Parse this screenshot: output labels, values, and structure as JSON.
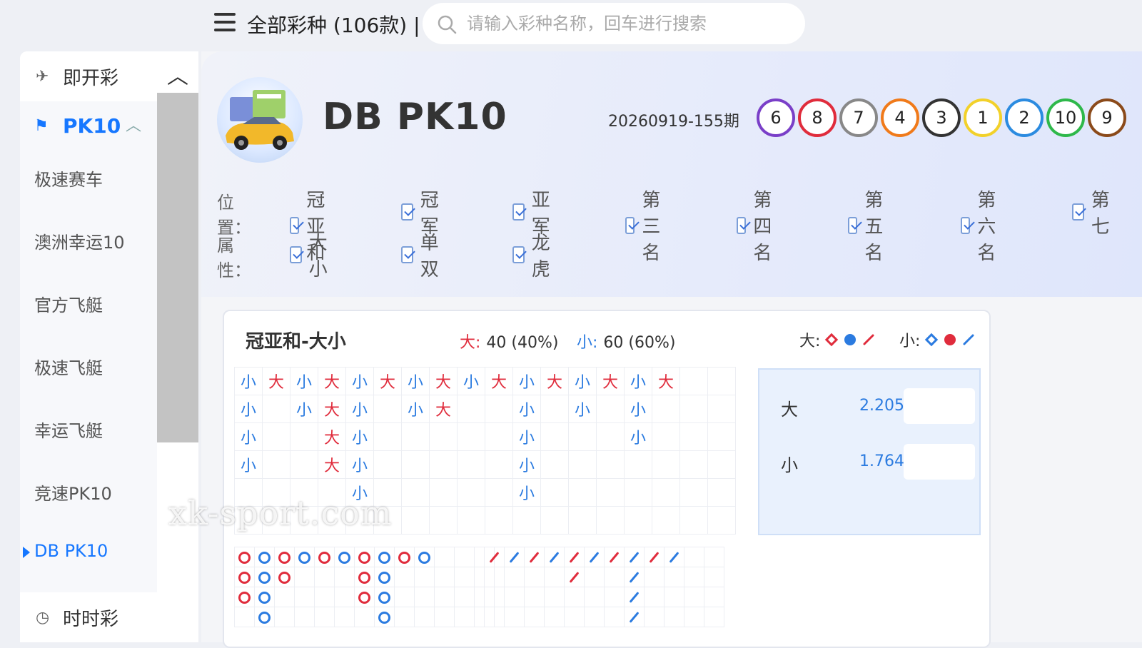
{
  "topbar": {
    "all_games_label": "全部彩种 (106款) |",
    "search_placeholder": "请输入彩种名称，回车进行搜索"
  },
  "sidebar": {
    "group_instant": "即开彩",
    "group_pk10": "PK10",
    "items": [
      "极速赛车",
      "澳洲幸运10",
      "官方飞艇",
      "极速飞艇",
      "幸运飞艇",
      "竞速PK10",
      "DB PK10"
    ],
    "active_item": "DB PK10",
    "group_ssc": "时时彩"
  },
  "game": {
    "title": "DB PK10",
    "issue": "20260919-155期",
    "balls": [
      {
        "num": "6",
        "color": "#7a3fc8"
      },
      {
        "num": "8",
        "color": "#e02c3c"
      },
      {
        "num": "7",
        "color": "#888888"
      },
      {
        "num": "4",
        "color": "#f07a1a"
      },
      {
        "num": "3",
        "color": "#333333"
      },
      {
        "num": "1",
        "color": "#f2d12a"
      },
      {
        "num": "2",
        "color": "#2b8be0"
      },
      {
        "num": "10",
        "color": "#2eb84a"
      },
      {
        "num": "9",
        "color": "#8b4a1a"
      }
    ]
  },
  "filters": {
    "position_label": "位置：",
    "positions": [
      "冠亚和",
      "冠军",
      "亚军",
      "第三名",
      "第四名",
      "第五名",
      "第六名",
      "第七"
    ],
    "attribute_label": "属性：",
    "attributes": [
      "大小",
      "单双",
      "龙虎"
    ]
  },
  "card": {
    "title": "冠亚和-大小",
    "big_label": "大:",
    "big_value": "40 (40%)",
    "small_label": "小:",
    "small_value": "60 (60%)",
    "legend_big": "大:",
    "legend_small": "小:",
    "odds": [
      {
        "name": "大",
        "value": "2.205"
      },
      {
        "name": "小",
        "value": "1.764"
      }
    ],
    "road_columns": [
      [
        "小",
        "小",
        "小",
        "小"
      ],
      [
        "大"
      ],
      [
        "小",
        "小"
      ],
      [
        "大",
        "大",
        "大",
        "大"
      ],
      [
        "小",
        "小",
        "小",
        "小",
        "小"
      ],
      [
        "大"
      ],
      [
        "小",
        "小"
      ],
      [
        "大",
        "大"
      ],
      [
        "小"
      ],
      [
        "大"
      ],
      [
        "小",
        "小",
        "小",
        "小",
        "小"
      ],
      [
        "大"
      ],
      [
        "小",
        "小"
      ],
      [
        "大"
      ],
      [
        "小",
        "小",
        "小"
      ],
      [
        "大"
      ],
      [],
      []
    ],
    "bead_columns": [
      [
        "r",
        "r",
        "r"
      ],
      [
        "b",
        "b",
        "b",
        "b"
      ],
      [
        "r",
        "r"
      ],
      [
        "b"
      ],
      [
        "r"
      ],
      [
        "b"
      ],
      [
        "r",
        "r",
        "r"
      ],
      [
        "b",
        "b",
        "b",
        "b"
      ],
      [
        "r"
      ],
      [
        "b"
      ],
      [],
      [],
      []
    ],
    "slash_columns": [
      [
        "r"
      ],
      [
        "b"
      ],
      [
        "r"
      ],
      [
        "b"
      ],
      [
        "r",
        "r"
      ],
      [
        "b"
      ],
      [
        "r"
      ],
      [
        "b",
        "b",
        "b",
        "b"
      ],
      [
        "r"
      ],
      [
        "b"
      ],
      [],
      []
    ]
  },
  "watermark": "xk-sport.com"
}
